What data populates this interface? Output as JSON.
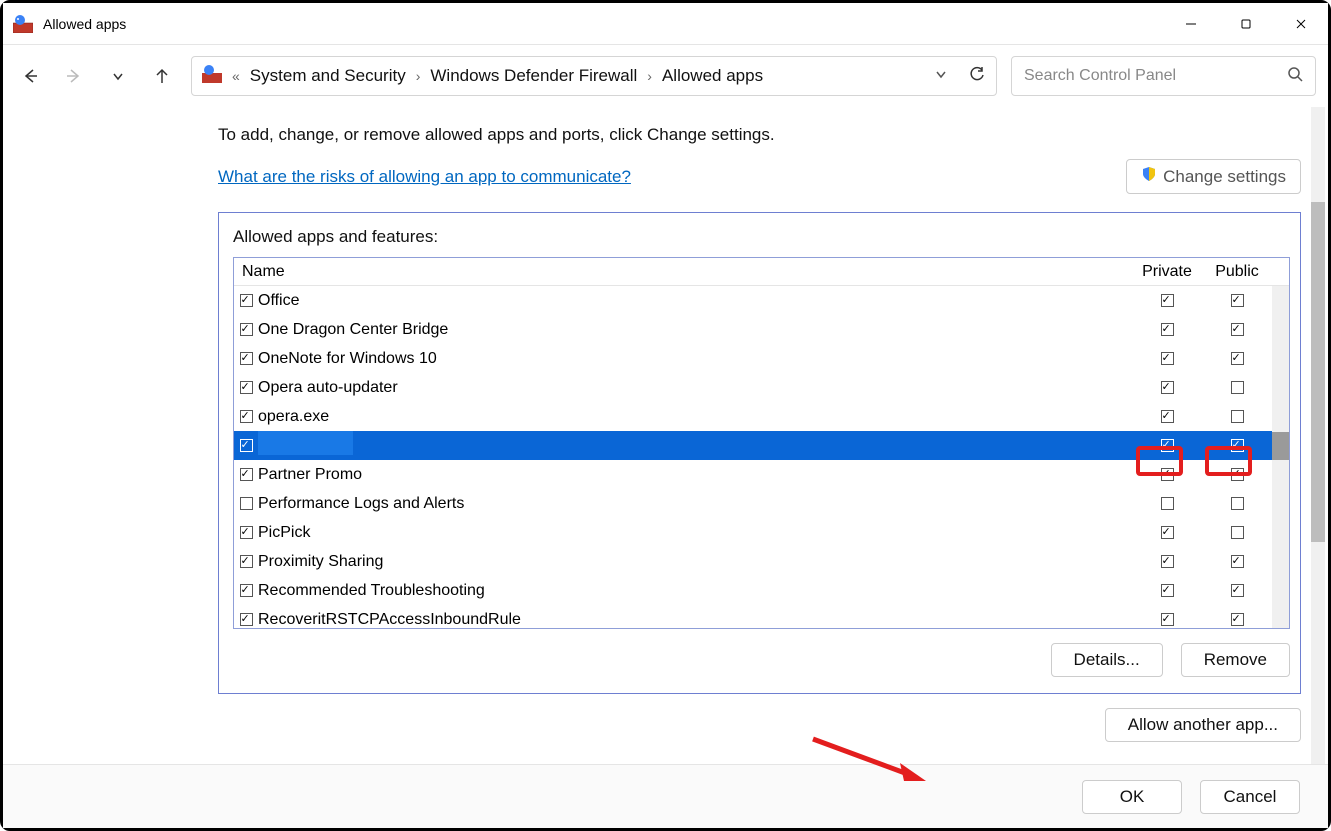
{
  "window": {
    "title": "Allowed apps"
  },
  "breadcrumbs": {
    "seg1": "System and Security",
    "seg2": "Windows Defender Firewall",
    "seg3": "Allowed apps"
  },
  "search": {
    "placeholder": "Search Control Panel"
  },
  "intro": "To add, change, or remove allowed apps and ports, click Change settings.",
  "risks_link": "What are the risks of allowing an app to communicate?",
  "change_settings": "Change settings",
  "group_label": "Allowed apps and features:",
  "columns": {
    "name": "Name",
    "private": "Private",
    "public": "Public"
  },
  "rows": [
    {
      "enabled": true,
      "name": "Office",
      "private": true,
      "public": true
    },
    {
      "enabled": true,
      "name": "One Dragon Center Bridge",
      "private": true,
      "public": true
    },
    {
      "enabled": true,
      "name": "OneNote for Windows 10",
      "private": true,
      "public": true
    },
    {
      "enabled": true,
      "name": "Opera auto-updater",
      "private": true,
      "public": false
    },
    {
      "enabled": true,
      "name": "opera.exe",
      "private": true,
      "public": false
    },
    {
      "enabled": true,
      "name": "",
      "private": true,
      "public": true,
      "selected": true
    },
    {
      "enabled": true,
      "name": "Partner Promo",
      "private": true,
      "public": true
    },
    {
      "enabled": false,
      "name": "Performance Logs and Alerts",
      "private": false,
      "public": false
    },
    {
      "enabled": true,
      "name": "PicPick",
      "private": true,
      "public": false
    },
    {
      "enabled": true,
      "name": "Proximity Sharing",
      "private": true,
      "public": true
    },
    {
      "enabled": true,
      "name": "Recommended Troubleshooting",
      "private": true,
      "public": true
    },
    {
      "enabled": true,
      "name": "RecoveritRSTCPAccessInboundRule",
      "private": true,
      "public": true
    }
  ],
  "buttons": {
    "details": "Details...",
    "remove": "Remove",
    "allow_another": "Allow another app...",
    "ok": "OK",
    "cancel": "Cancel"
  }
}
